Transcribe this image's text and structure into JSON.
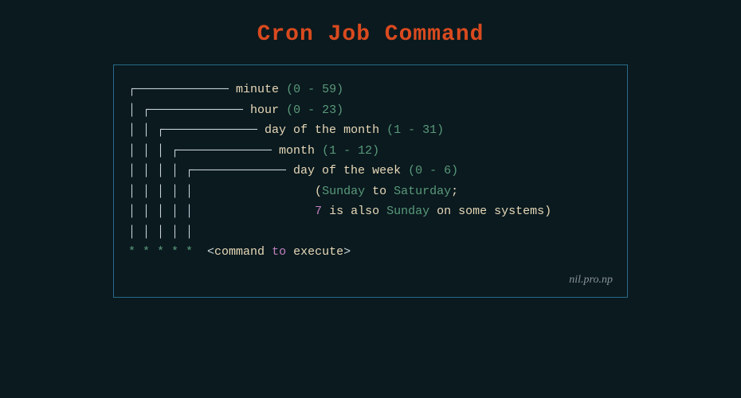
{
  "title": "Cron Job Command",
  "fields": {
    "minute": {
      "label": "minute",
      "range": "(0 - 59)"
    },
    "hour": {
      "label": "hour",
      "range": "(0 - 23)"
    },
    "dom": {
      "label": "day of the month",
      "range": "(1 - 31)"
    },
    "month": {
      "label": "month",
      "range": "(1 - 12)"
    },
    "dow": {
      "label": "day of the week",
      "range": "(0 - 6)"
    }
  },
  "dow_note": {
    "open": "(",
    "sunday": "Sunday",
    "to": " to ",
    "saturday": "Saturday",
    "semi": ";",
    "seven": "7",
    "is_also": " is also ",
    "sunday2": "Sunday",
    "rest": " on some systems)",
    "on": "on"
  },
  "stars": "* * * * *",
  "command": {
    "open": "<",
    "cmd": "command",
    "to": "to",
    "exec": "execute",
    "close": ">"
  },
  "credit": "nil.pro.np"
}
